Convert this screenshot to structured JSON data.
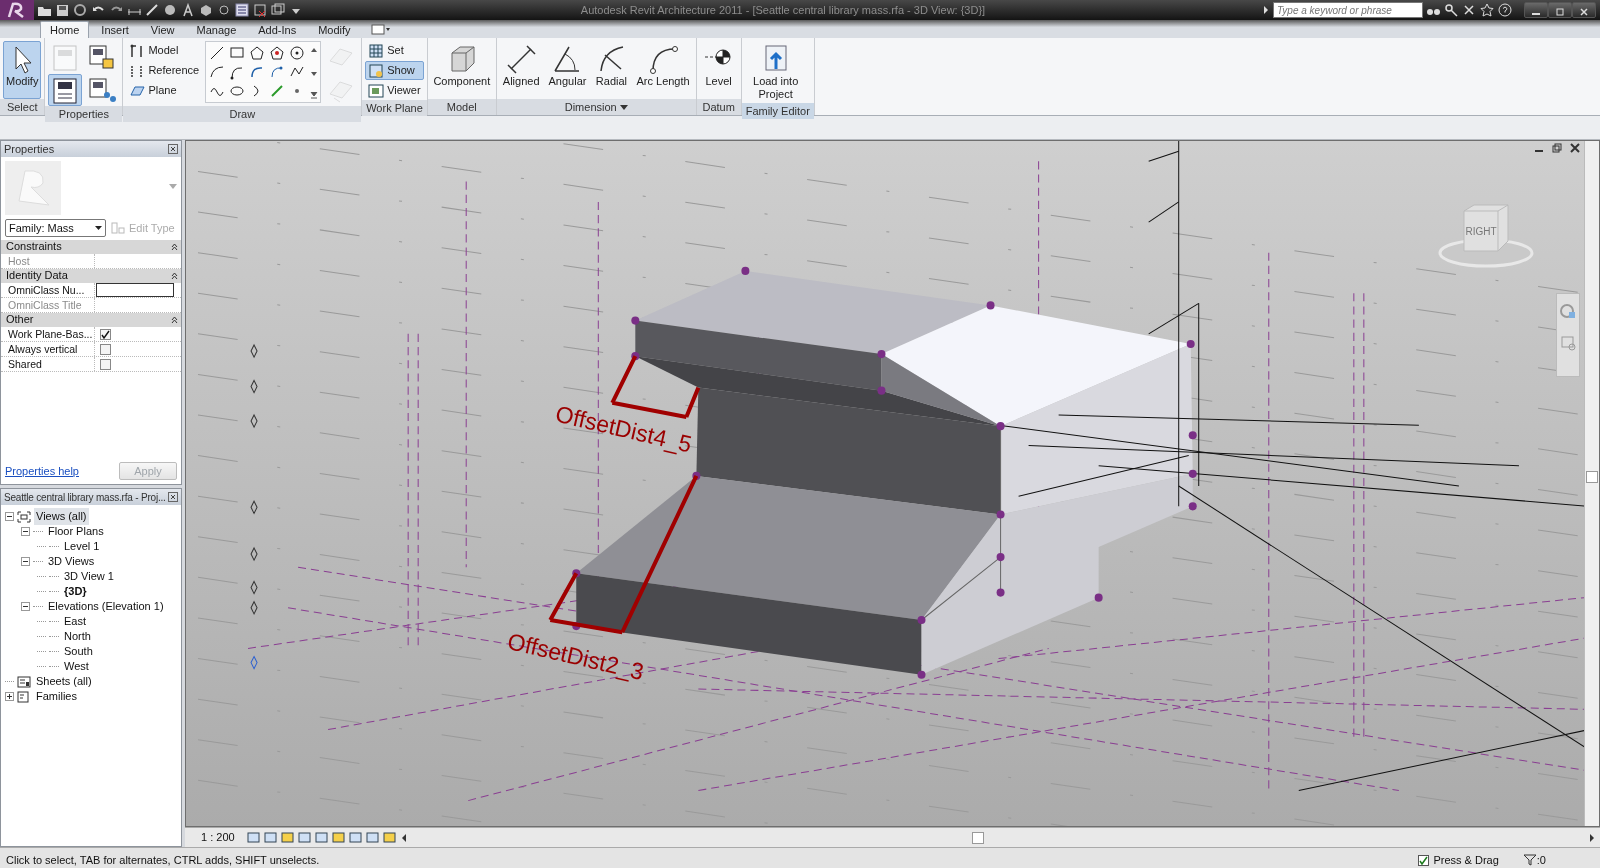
{
  "window": {
    "title": "Autodesk Revit Architecture 2011 - [Seattle central library mass.rfa - 3D View: {3D}]"
  },
  "search": {
    "placeholder": "Type a keyword or phrase"
  },
  "tabs": [
    {
      "label": "Home",
      "selected": true
    },
    {
      "label": "Insert",
      "selected": false
    },
    {
      "label": "View",
      "selected": false
    },
    {
      "label": "Manage",
      "selected": false
    },
    {
      "label": "Add-Ins",
      "selected": false
    },
    {
      "label": "Modify",
      "selected": false
    }
  ],
  "ribbon_panels": [
    {
      "title": "Select",
      "contextual": false,
      "has_menu": false,
      "tools": [
        {
          "kind": "large",
          "label": "Modify",
          "selected": true,
          "disabled": false
        }
      ]
    },
    {
      "title": "Properties",
      "contextual": false,
      "has_menu": false,
      "tools": [
        {
          "kind": "icon",
          "selected": false,
          "disabled": true
        },
        {
          "kind": "icon",
          "selected": true,
          "disabled": false
        },
        {
          "kind": "icon",
          "selected": false,
          "disabled": false
        },
        {
          "kind": "icon",
          "selected": false,
          "disabled": false
        }
      ]
    },
    {
      "title": "Draw",
      "contextual": false,
      "has_menu": false,
      "tools": [
        {
          "kind": "small",
          "label": "Model",
          "selected": false,
          "disabled": false
        },
        {
          "kind": "small",
          "label": "Reference",
          "selected": false,
          "disabled": false
        },
        {
          "kind": "small",
          "label": "Plane",
          "selected": false,
          "disabled": false
        },
        {
          "kind": "gallery"
        },
        {
          "kind": "icon",
          "selected": false,
          "disabled": true
        },
        {
          "kind": "icon",
          "selected": false,
          "disabled": true
        }
      ]
    },
    {
      "title": "Work Plane",
      "contextual": false,
      "has_menu": false,
      "tools": [
        {
          "kind": "small",
          "label": "Set",
          "selected": false,
          "disabled": false
        },
        {
          "kind": "small",
          "label": "Show",
          "selected": true,
          "disabled": false
        },
        {
          "kind": "small",
          "label": "Viewer",
          "selected": false,
          "disabled": false
        }
      ]
    },
    {
      "title": "Model",
      "contextual": false,
      "has_menu": false,
      "tools": [
        {
          "kind": "large",
          "label": "Component",
          "selected": false,
          "disabled": false
        }
      ]
    },
    {
      "title": "Dimension",
      "contextual": false,
      "has_menu": true,
      "tools": [
        {
          "kind": "large",
          "label": "Aligned",
          "selected": false,
          "disabled": false
        },
        {
          "kind": "large",
          "label": "Angular",
          "selected": false,
          "disabled": false
        },
        {
          "kind": "large",
          "label": "Radial",
          "selected": false,
          "disabled": false
        },
        {
          "kind": "large",
          "label": "Arc Length",
          "selected": false,
          "disabled": false
        }
      ]
    },
    {
      "title": "Datum",
      "contextual": false,
      "has_menu": false,
      "tools": [
        {
          "kind": "large",
          "label": "Level",
          "selected": false,
          "disabled": false
        }
      ]
    },
    {
      "title": "Family Editor",
      "contextual": true,
      "has_menu": false,
      "tools": [
        {
          "kind": "large",
          "label": "Load into Project",
          "selected": false,
          "disabled": false
        }
      ]
    }
  ],
  "properties": {
    "title": "Properties",
    "type_selector": "Family: Mass",
    "edit_type": {
      "label": "Edit Type",
      "disabled": true
    },
    "groups": [
      {
        "name": "Constraints",
        "expanded": true,
        "rows": [
          {
            "kind": "text",
            "label": "Host",
            "disabled": true
          }
        ]
      },
      {
        "name": "Identity Data",
        "expanded": true,
        "rows": [
          {
            "kind": "field",
            "label": "OmniClass Nu...",
            "disabled": false
          },
          {
            "kind": "text",
            "label": "OmniClass Title",
            "disabled": true
          }
        ]
      },
      {
        "name": "Other",
        "expanded": true,
        "rows": [
          {
            "kind": "checkbox",
            "label": "Work Plane-Bas...",
            "checked": true,
            "disabled": false
          },
          {
            "kind": "checkbox",
            "label": "Always vertical",
            "checked": false,
            "disabled": false
          },
          {
            "kind": "checkbox",
            "label": "Shared",
            "checked": false,
            "disabled": false
          }
        ]
      }
    ],
    "help_link": "Properties help",
    "apply": {
      "label": "Apply",
      "disabled": true
    }
  },
  "browser": {
    "title": "Seattle central library mass.rfa - Proj...",
    "tree": [
      {
        "label": "Views (all)",
        "selected": true,
        "current": false,
        "expanded": true,
        "children": [
          {
            "label": "Floor Plans",
            "selected": false,
            "current": false,
            "expanded": true,
            "children": [
              {
                "label": "Level 1",
                "selected": false,
                "current": false
              }
            ]
          },
          {
            "label": "3D Views",
            "selected": false,
            "current": false,
            "expanded": true,
            "children": [
              {
                "label": "3D View 1",
                "selected": false,
                "current": false
              },
              {
                "label": "{3D}",
                "selected": false,
                "current": true
              }
            ]
          },
          {
            "label": "Elevations (Elevation 1)",
            "selected": false,
            "current": false,
            "expanded": true,
            "children": [
              {
                "label": "East",
                "selected": false,
                "current": false
              },
              {
                "label": "North",
                "selected": false,
                "current": false
              },
              {
                "label": "South",
                "selected": false,
                "current": false
              },
              {
                "label": "West",
                "selected": false,
                "current": false
              }
            ]
          }
        ]
      },
      {
        "label": "Sheets (all)",
        "selected": false,
        "current": false
      },
      {
        "label": "Families",
        "selected": false,
        "current": false,
        "expanded": false
      }
    ]
  },
  "view": {
    "annotations": [
      {
        "label": "OffsetDist4_5"
      },
      {
        "label": "OffsetDist2_3"
      }
    ],
    "view_cube": {
      "face": "RIGHT"
    },
    "scale": "1 : 200"
  },
  "status_bar": {
    "message": "Click to select, TAB for alternates, CTRL adds, SHIFT unselects.",
    "press_drag": {
      "label": "Press & Drag",
      "checked": true
    },
    "selection_count": ":0"
  }
}
